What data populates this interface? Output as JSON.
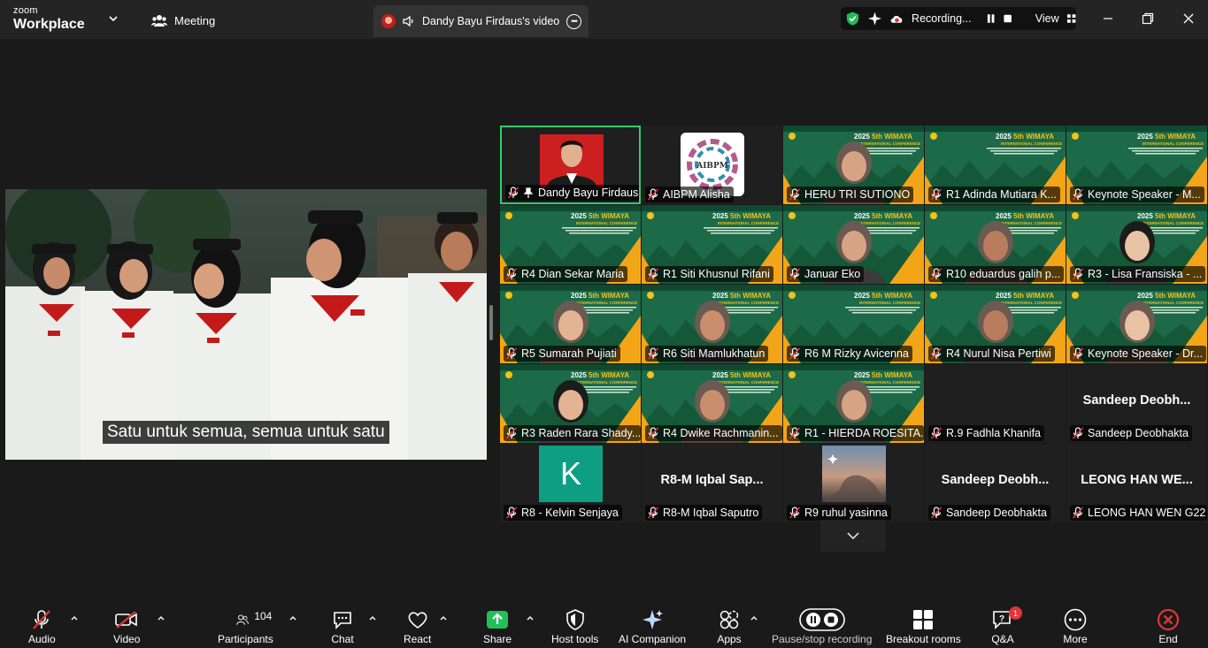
{
  "app": {
    "brand_top": "zoom",
    "brand_bottom": "Workplace",
    "meeting_label": "Meeting"
  },
  "tab": {
    "title": "Dandy Bayu Firdaus's video f"
  },
  "status": {
    "recording_text": "Recording...",
    "view_label": "View"
  },
  "shared_video": {
    "caption": "Satu untuk semua, semua untuk satu"
  },
  "tiles": [
    {
      "name": "Dandy Bayu Firdaus",
      "bg": "avatar-photo",
      "pinned": true,
      "active": true
    },
    {
      "name": "AIBPM Alisha",
      "bg": "logo",
      "logo_text": "AIBPM"
    },
    {
      "name": "HERU TRI SUTIONO",
      "bg": "banner-video"
    },
    {
      "name": "R1 Adinda Mutiara K...",
      "bg": "banner"
    },
    {
      "name": "Keynote Speaker - M...",
      "bg": "banner"
    },
    {
      "name": "R4 Dian Sekar Maria",
      "bg": "banner"
    },
    {
      "name": "R1 Siti Khusnul Rifani",
      "bg": "banner"
    },
    {
      "name": "Januar Eko",
      "bg": "banner-video"
    },
    {
      "name": "R10 eduardus galih p...",
      "bg": "banner-video"
    },
    {
      "name": "R3 - Lisa Fransiska - ...",
      "bg": "banner-video"
    },
    {
      "name": "R5 Sumarah Pujiati",
      "bg": "banner-video"
    },
    {
      "name": "R6 Siti Mamlukhatun",
      "bg": "banner-video"
    },
    {
      "name": "R6 M Rizky Avicenna",
      "bg": "banner"
    },
    {
      "name": "R4 Nurul Nisa Pertiwi",
      "bg": "banner-video"
    },
    {
      "name": "Keynote Speaker - Dr...",
      "bg": "banner-video"
    },
    {
      "name": "R3 Raden Rara Shady...",
      "bg": "banner-video"
    },
    {
      "name": "R4 Dwike Rachmanin...",
      "bg": "banner-video"
    },
    {
      "name": "R1 - HIERDA ROESITA...",
      "bg": "banner-video"
    },
    {
      "name": "R.9 Fadhla Khanifa",
      "bg": "dark"
    },
    {
      "name": "Sandeep Deobhakta",
      "bg": "dark",
      "big_name": "Sandeep  Deobh..."
    },
    {
      "name": "R8 - Kelvin Senjaya",
      "bg": "initial",
      "initial": "K"
    },
    {
      "name": "R8-M Iqbal Saputro",
      "bg": "dark",
      "big_name": "R8-M  Iqbal  Sap..."
    },
    {
      "name": "R9 ruhul yasinna",
      "bg": "sky-photo"
    },
    {
      "name": "Sandeep Deobhakta",
      "bg": "dark",
      "big_name": "Sandeep  Deobh..."
    },
    {
      "name": "LEONG HAN WEN G22",
      "bg": "dark",
      "big_name": "LEONG  HAN  WE..."
    }
  ],
  "banner_text": {
    "year": "2025",
    "edition": "5th",
    "event": "WIMAYA",
    "sub": "INTERNATIONAL CONFERENCE"
  },
  "toolbar": {
    "audio": "Audio",
    "video": "Video",
    "participants": "Participants",
    "participants_count": "104",
    "chat": "Chat",
    "react": "React",
    "share": "Share",
    "host_tools": "Host tools",
    "ai_companion": "AI Companion",
    "apps": "Apps",
    "pause_recording": "Pause/stop recording",
    "breakout_rooms": "Breakout rooms",
    "qa": "Q&A",
    "qa_badge": "1",
    "more": "More",
    "end": "End"
  },
  "colors": {
    "accent_green": "#2ecf6b",
    "end_red": "#e0353a",
    "banner_green": "#1e6b4a",
    "banner_orange": "#f2a516"
  }
}
